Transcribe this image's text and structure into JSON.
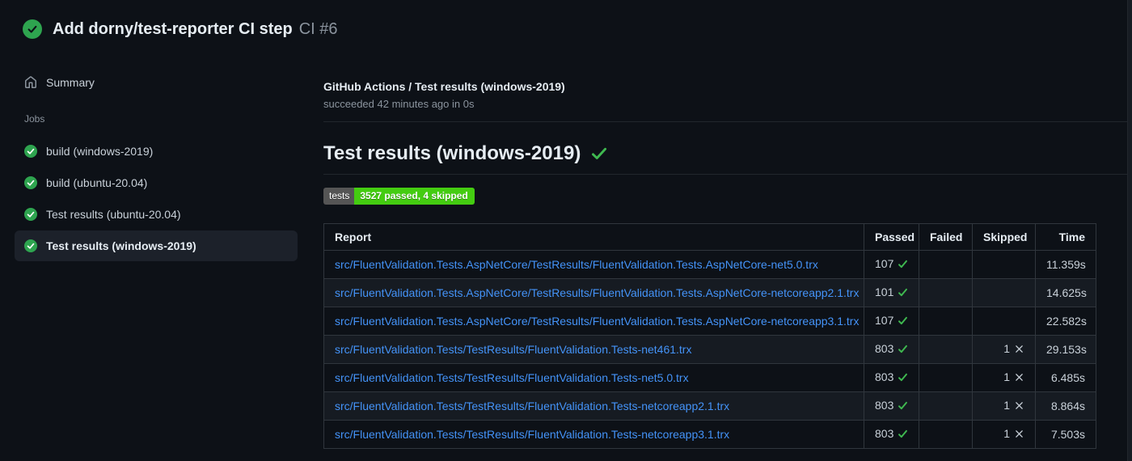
{
  "run_header": {
    "title": "Add dorny/test-reporter CI step",
    "run_number": "CI #6"
  },
  "sidebar": {
    "summary_label": "Summary",
    "jobs_label": "Jobs",
    "jobs": [
      {
        "label": "build (windows-2019)",
        "status": "success",
        "selected": false
      },
      {
        "label": "build (ubuntu-20.04)",
        "status": "success",
        "selected": false
      },
      {
        "label": "Test results (ubuntu-20.04)",
        "status": "success",
        "selected": false
      },
      {
        "label": "Test results (windows-2019)",
        "status": "success",
        "selected": true
      }
    ]
  },
  "job_header": {
    "title": "GitHub Actions / Test results (windows-2019)",
    "status_line": "succeeded 42 minutes ago in 0s"
  },
  "report": {
    "heading": "Test results (windows-2019)",
    "badge": {
      "label": "tests",
      "value": "3527 passed, 4 skipped"
    },
    "table": {
      "columns": [
        "Report",
        "Passed",
        "Failed",
        "Skipped",
        "Time"
      ],
      "rows": [
        {
          "report": "src/FluentValidation.Tests.AspNetCore/TestResults/FluentValidation.Tests.AspNetCore-net5.0.trx",
          "passed": "107",
          "failed": "",
          "skipped": "",
          "time": "11.359s"
        },
        {
          "report": "src/FluentValidation.Tests.AspNetCore/TestResults/FluentValidation.Tests.AspNetCore-netcoreapp2.1.trx",
          "passed": "101",
          "failed": "",
          "skipped": "",
          "time": "14.625s"
        },
        {
          "report": "src/FluentValidation.Tests.AspNetCore/TestResults/FluentValidation.Tests.AspNetCore-netcoreapp3.1.trx",
          "passed": "107",
          "failed": "",
          "skipped": "",
          "time": "22.582s"
        },
        {
          "report": "src/FluentValidation.Tests/TestResults/FluentValidation.Tests-net461.trx",
          "passed": "803",
          "failed": "",
          "skipped": "1",
          "time": "29.153s"
        },
        {
          "report": "src/FluentValidation.Tests/TestResults/FluentValidation.Tests-net5.0.trx",
          "passed": "803",
          "failed": "",
          "skipped": "1",
          "time": "6.485s"
        },
        {
          "report": "src/FluentValidation.Tests/TestResults/FluentValidation.Tests-netcoreapp2.1.trx",
          "passed": "803",
          "failed": "",
          "skipped": "1",
          "time": "8.864s"
        },
        {
          "report": "src/FluentValidation.Tests/TestResults/FluentValidation.Tests-netcoreapp3.1.trx",
          "passed": "803",
          "failed": "",
          "skipped": "1",
          "time": "7.503s"
        }
      ]
    }
  },
  "colors": {
    "page_bg": "#0d1117",
    "success_green": "#2ea44f",
    "check_green": "#3fb950",
    "link_blue": "#4493f8",
    "badge_label_bg": "#555555",
    "badge_value_bg": "#44cc11",
    "selected_item_bg": "#1c212a",
    "border": "#30363d",
    "muted_text": "#8b949e"
  }
}
